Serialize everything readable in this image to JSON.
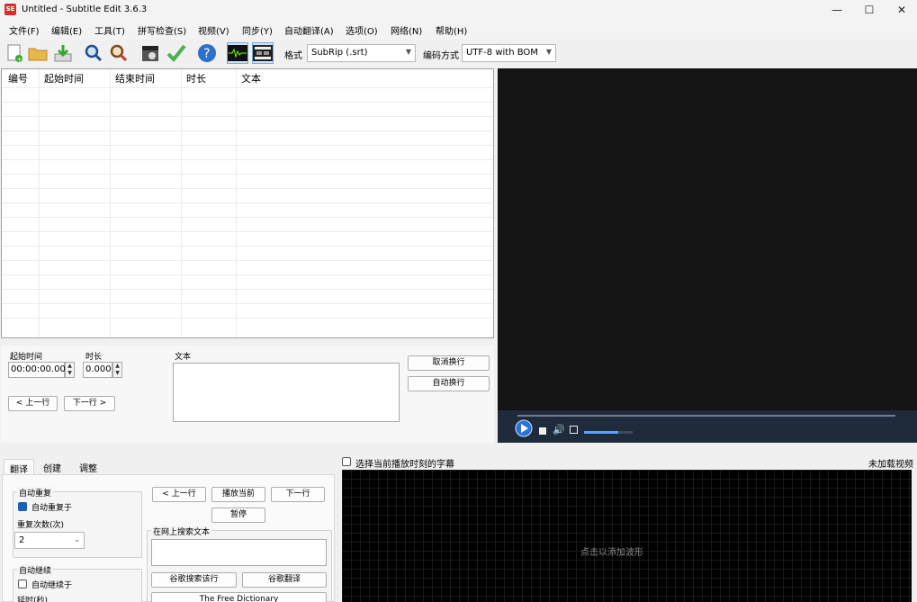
{
  "window": {
    "title": "Untitled - Subtitle Edit 3.6.3",
    "logo": "SE"
  },
  "window_controls": {
    "minimize": "—",
    "maximize": "☐",
    "close": "✕"
  },
  "menu": [
    "文件(F)",
    "编辑(E)",
    "工具(T)",
    "拼写检查(S)",
    "视频(V)",
    "同步(Y)",
    "自动翻译(A)",
    "选项(O)",
    "网络(N)",
    "帮助(H)"
  ],
  "toolbar": {
    "icons": [
      "new-file-icon",
      "open-folder-icon",
      "download-icon",
      "find-icon",
      "replace-icon",
      "video-clapper-icon",
      "check-icon",
      "help-icon",
      "waveform-icon",
      "film-strip-icon"
    ],
    "format_label": "格式",
    "format_value": "SubRip (.srt)",
    "encoding_label": "编码方式",
    "encoding_value": "UTF-8 with BOM"
  },
  "grid": {
    "columns": [
      "编号",
      "起始时间",
      "结束时间",
      "时长",
      "文本"
    ]
  },
  "edit": {
    "start_label": "起始时间",
    "start_value": "00:00:00.000",
    "duration_label": "时长",
    "duration_value": "0.000",
    "text_label": "文本",
    "prev_button": "< 上一行",
    "next_button": "下一行 >",
    "unbreak_button": "取消换行",
    "autobreak_button": "自动换行"
  },
  "bottom": {
    "tabs": [
      "翻译",
      "创建",
      "调整"
    ],
    "auto_repeat_group": "自动重复",
    "auto_repeat_check": "自动重复于",
    "repeat_count_label": "重复次数(次)",
    "repeat_count_value": "2",
    "auto_continue_group": "自动继续",
    "auto_continue_check": "自动继续于",
    "delay_label": "延时(秒)",
    "prev_line": "< 上一行",
    "play_current": "播放当前",
    "next_line": "下一行",
    "pause": "暂停",
    "web_search_label": "在网上搜索文本",
    "google_search": "谷歌搜索该行",
    "google_translate": "谷歌翻译",
    "free_dictionary": "The Free Dictionary",
    "select_current_label": "选择当前播放时刻的字幕",
    "no_video": "未加载视频",
    "waveform_hint": "点击以添加波形"
  },
  "colors": {
    "accent": "#1a5fb4",
    "video_bg": "#141414",
    "waveform_bg": "#000000"
  }
}
